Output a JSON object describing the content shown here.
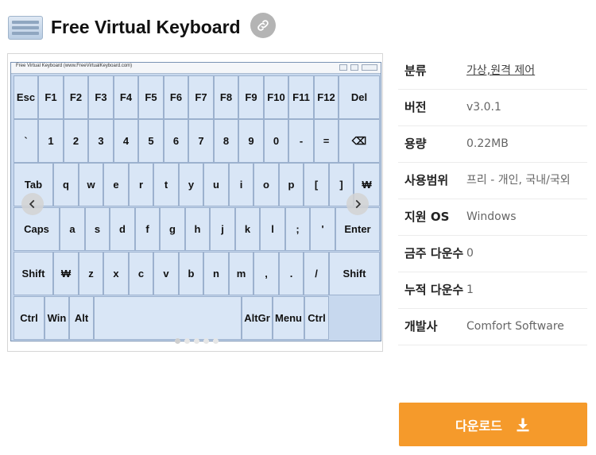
{
  "header": {
    "title": "Free Virtual Keyboard",
    "icon": "keyboard-app-icon",
    "link_icon": "link-icon"
  },
  "screenshot": {
    "window_title": "Free Virtual Keyboard (www.FreeVirtualKeyboard.com)",
    "rows": [
      [
        "Esc",
        "F1",
        "F2",
        "F3",
        "F4",
        "F5",
        "F6",
        "F7",
        "F8",
        "F9",
        "F10",
        "F11",
        "F12",
        "Del"
      ],
      [
        "`",
        "1",
        "2",
        "3",
        "4",
        "5",
        "6",
        "7",
        "8",
        "9",
        "0",
        "-",
        "=",
        "⌫"
      ],
      [
        "Tab",
        "q",
        "w",
        "e",
        "r",
        "t",
        "y",
        "u",
        "i",
        "o",
        "p",
        "[",
        "]",
        "₩"
      ],
      [
        "Caps",
        "a",
        "s",
        "d",
        "f",
        "g",
        "h",
        "j",
        "k",
        "l",
        ";",
        "'",
        "Enter"
      ],
      [
        "Shift",
        "₩",
        "z",
        "x",
        "c",
        "v",
        "b",
        "n",
        "m",
        ",",
        ".",
        "/",
        "Shift"
      ],
      [
        "Ctrl",
        "Win",
        "Alt",
        "",
        "AltGr",
        "Menu",
        "Ctrl"
      ]
    ],
    "prev_icon": "chevron-left-icon",
    "next_icon": "chevron-right-icon",
    "slide_count": 5,
    "active_slide": 0
  },
  "info": [
    {
      "key": "분류",
      "value": "가상,원격 제어",
      "link": true
    },
    {
      "key": "버전",
      "value": "v3.0.1",
      "link": false
    },
    {
      "key": "용량",
      "value": "0.22MB",
      "link": false
    },
    {
      "key": "사용범위",
      "value": "프리 - 개인, 국내/국외",
      "link": false
    },
    {
      "key": "지원 OS",
      "value": "Windows",
      "link": false
    },
    {
      "key": "금주 다운수",
      "value": "0",
      "link": false
    },
    {
      "key": "누적 다운수",
      "value": "1",
      "link": false
    },
    {
      "key": "개발사",
      "value": "Comfort Software",
      "link": false
    }
  ],
  "download": {
    "label": "다운로드",
    "icon": "download-icon"
  },
  "colors": {
    "accent": "#f59a2b",
    "key_bg": "#d9e6f6",
    "window_bg": "#c7d8ee"
  }
}
